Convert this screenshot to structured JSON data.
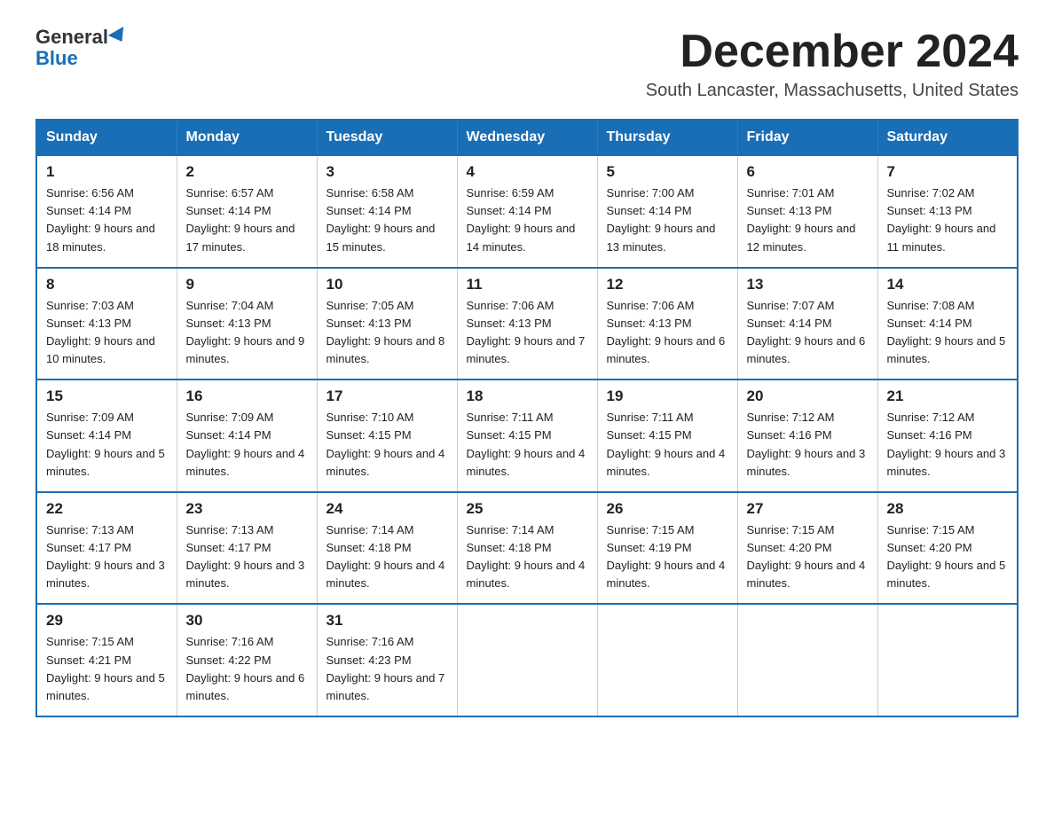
{
  "logo": {
    "general": "General",
    "blue": "Blue"
  },
  "title": "December 2024",
  "location": "South Lancaster, Massachusetts, United States",
  "days_of_week": [
    "Sunday",
    "Monday",
    "Tuesday",
    "Wednesday",
    "Thursday",
    "Friday",
    "Saturday"
  ],
  "weeks": [
    [
      {
        "day": "1",
        "sunrise": "6:56 AM",
        "sunset": "4:14 PM",
        "daylight": "9 hours and 18 minutes."
      },
      {
        "day": "2",
        "sunrise": "6:57 AM",
        "sunset": "4:14 PM",
        "daylight": "9 hours and 17 minutes."
      },
      {
        "day": "3",
        "sunrise": "6:58 AM",
        "sunset": "4:14 PM",
        "daylight": "9 hours and 15 minutes."
      },
      {
        "day": "4",
        "sunrise": "6:59 AM",
        "sunset": "4:14 PM",
        "daylight": "9 hours and 14 minutes."
      },
      {
        "day": "5",
        "sunrise": "7:00 AM",
        "sunset": "4:14 PM",
        "daylight": "9 hours and 13 minutes."
      },
      {
        "day": "6",
        "sunrise": "7:01 AM",
        "sunset": "4:13 PM",
        "daylight": "9 hours and 12 minutes."
      },
      {
        "day": "7",
        "sunrise": "7:02 AM",
        "sunset": "4:13 PM",
        "daylight": "9 hours and 11 minutes."
      }
    ],
    [
      {
        "day": "8",
        "sunrise": "7:03 AM",
        "sunset": "4:13 PM",
        "daylight": "9 hours and 10 minutes."
      },
      {
        "day": "9",
        "sunrise": "7:04 AM",
        "sunset": "4:13 PM",
        "daylight": "9 hours and 9 minutes."
      },
      {
        "day": "10",
        "sunrise": "7:05 AM",
        "sunset": "4:13 PM",
        "daylight": "9 hours and 8 minutes."
      },
      {
        "day": "11",
        "sunrise": "7:06 AM",
        "sunset": "4:13 PM",
        "daylight": "9 hours and 7 minutes."
      },
      {
        "day": "12",
        "sunrise": "7:06 AM",
        "sunset": "4:13 PM",
        "daylight": "9 hours and 6 minutes."
      },
      {
        "day": "13",
        "sunrise": "7:07 AM",
        "sunset": "4:14 PM",
        "daylight": "9 hours and 6 minutes."
      },
      {
        "day": "14",
        "sunrise": "7:08 AM",
        "sunset": "4:14 PM",
        "daylight": "9 hours and 5 minutes."
      }
    ],
    [
      {
        "day": "15",
        "sunrise": "7:09 AM",
        "sunset": "4:14 PM",
        "daylight": "9 hours and 5 minutes."
      },
      {
        "day": "16",
        "sunrise": "7:09 AM",
        "sunset": "4:14 PM",
        "daylight": "9 hours and 4 minutes."
      },
      {
        "day": "17",
        "sunrise": "7:10 AM",
        "sunset": "4:15 PM",
        "daylight": "9 hours and 4 minutes."
      },
      {
        "day": "18",
        "sunrise": "7:11 AM",
        "sunset": "4:15 PM",
        "daylight": "9 hours and 4 minutes."
      },
      {
        "day": "19",
        "sunrise": "7:11 AM",
        "sunset": "4:15 PM",
        "daylight": "9 hours and 4 minutes."
      },
      {
        "day": "20",
        "sunrise": "7:12 AM",
        "sunset": "4:16 PM",
        "daylight": "9 hours and 3 minutes."
      },
      {
        "day": "21",
        "sunrise": "7:12 AM",
        "sunset": "4:16 PM",
        "daylight": "9 hours and 3 minutes."
      }
    ],
    [
      {
        "day": "22",
        "sunrise": "7:13 AM",
        "sunset": "4:17 PM",
        "daylight": "9 hours and 3 minutes."
      },
      {
        "day": "23",
        "sunrise": "7:13 AM",
        "sunset": "4:17 PM",
        "daylight": "9 hours and 3 minutes."
      },
      {
        "day": "24",
        "sunrise": "7:14 AM",
        "sunset": "4:18 PM",
        "daylight": "9 hours and 4 minutes."
      },
      {
        "day": "25",
        "sunrise": "7:14 AM",
        "sunset": "4:18 PM",
        "daylight": "9 hours and 4 minutes."
      },
      {
        "day": "26",
        "sunrise": "7:15 AM",
        "sunset": "4:19 PM",
        "daylight": "9 hours and 4 minutes."
      },
      {
        "day": "27",
        "sunrise": "7:15 AM",
        "sunset": "4:20 PM",
        "daylight": "9 hours and 4 minutes."
      },
      {
        "day": "28",
        "sunrise": "7:15 AM",
        "sunset": "4:20 PM",
        "daylight": "9 hours and 5 minutes."
      }
    ],
    [
      {
        "day": "29",
        "sunrise": "7:15 AM",
        "sunset": "4:21 PM",
        "daylight": "9 hours and 5 minutes."
      },
      {
        "day": "30",
        "sunrise": "7:16 AM",
        "sunset": "4:22 PM",
        "daylight": "9 hours and 6 minutes."
      },
      {
        "day": "31",
        "sunrise": "7:16 AM",
        "sunset": "4:23 PM",
        "daylight": "9 hours and 7 minutes."
      },
      null,
      null,
      null,
      null
    ]
  ]
}
